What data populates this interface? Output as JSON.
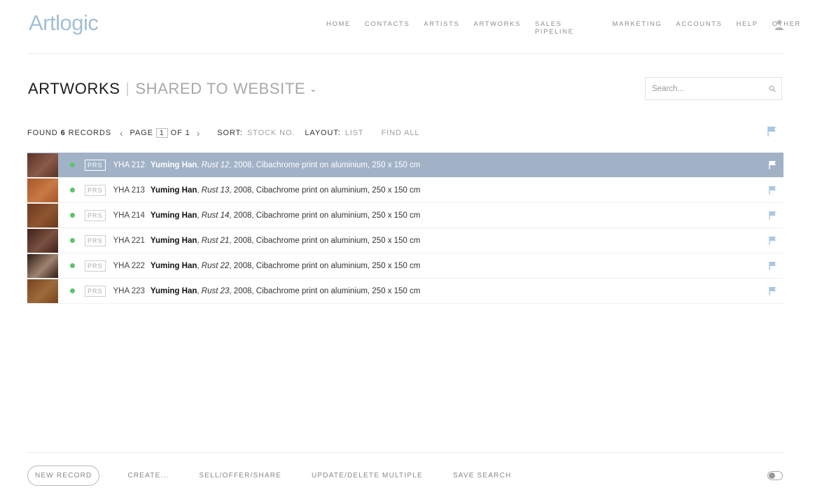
{
  "brand": {
    "logo_text": "Artlogic",
    "logo_color": "#a3bfd4"
  },
  "nav": {
    "items": [
      "HOME",
      "CONTACTS",
      "ARTISTS",
      "ARTWORKS",
      "SALES PIPELINE",
      "MARKETING",
      "ACCOUNTS",
      "HELP",
      "OTHER"
    ],
    "user_icon": "user-icon"
  },
  "page": {
    "title": "ARTWORKS",
    "separator": "|",
    "subtitle": "SHARED TO WEBSITE",
    "subtitle_icon": "chevron-down-icon"
  },
  "search": {
    "placeholder": "Search...",
    "value": "",
    "icon": "search-icon"
  },
  "toolbar": {
    "found_prefix": "FOUND",
    "found_count": "6",
    "found_suffix": "RECORDS",
    "page_label": "PAGE",
    "page_current": "1",
    "page_of": "OF 1",
    "sort_label": "SORT:",
    "sort_value": "STOCK NO.",
    "layout_label": "LAYOUT:",
    "layout_value": "LIST",
    "find_all": "FIND ALL",
    "flag_icon": "flag-icon"
  },
  "records": [
    {
      "stock": "YHA 212",
      "artist": "Yuming Han",
      "work": "Rust 12",
      "details": ", 2008, Cibachrome print on aluminium, 250 x 150 cm",
      "badge": "PRS",
      "selected": true,
      "thumb_colors": [
        "#5a3128",
        "#8a5a48"
      ]
    },
    {
      "stock": "YHA 213",
      "artist": "Yuming Han",
      "work": "Rust 13",
      "details": ", 2008, Cibachrome print on aluminium, 250 x 150 cm",
      "badge": "PRS",
      "selected": false,
      "thumb_colors": [
        "#a9552a",
        "#c67a44"
      ]
    },
    {
      "stock": "YHA 214",
      "artist": "Yuming Han",
      "work": "Rust 14",
      "details": ", 2008, Cibachrome print on aluminium, 250 x 150 cm",
      "badge": "PRS",
      "selected": false,
      "thumb_colors": [
        "#6b3a1e",
        "#8e5530"
      ]
    },
    {
      "stock": "YHA 221",
      "artist": "Yuming Han",
      "work": "Rust 21",
      "details": ", 2008, Cibachrome print on aluminium, 250 x 150 cm",
      "badge": "PRS",
      "selected": false,
      "thumb_colors": [
        "#3f2219",
        "#7a5040"
      ]
    },
    {
      "stock": "YHA 222",
      "artist": "Yuming Han",
      "work": "Rust 22",
      "details": ", 2008, Cibachrome print on aluminium, 250 x 150 cm",
      "badge": "PRS",
      "selected": false,
      "thumb_colors": [
        "#2d1c16",
        "#a08370"
      ]
    },
    {
      "stock": "YHA 223",
      "artist": "Yuming Han",
      "work": "Rust 23",
      "details": ", 2008, Cibachrome print on aluminium, 250 x 150 cm",
      "badge": "PRS",
      "selected": false,
      "thumb_colors": [
        "#7a4420",
        "#9c6a3a"
      ]
    }
  ],
  "footer": {
    "new_record": "NEW RECORD",
    "create": "CREATE...",
    "sell": "SELL/OFFER/SHARE",
    "update": "UPDATE/DELETE MULTIPLE",
    "save_search": "SAVE SEARCH",
    "toggle_icon": "toggle-switch"
  },
  "colors": {
    "selected_row": "#a1b2c7",
    "status_dot": "#5cc46a",
    "flag": "#a9c7e3"
  }
}
